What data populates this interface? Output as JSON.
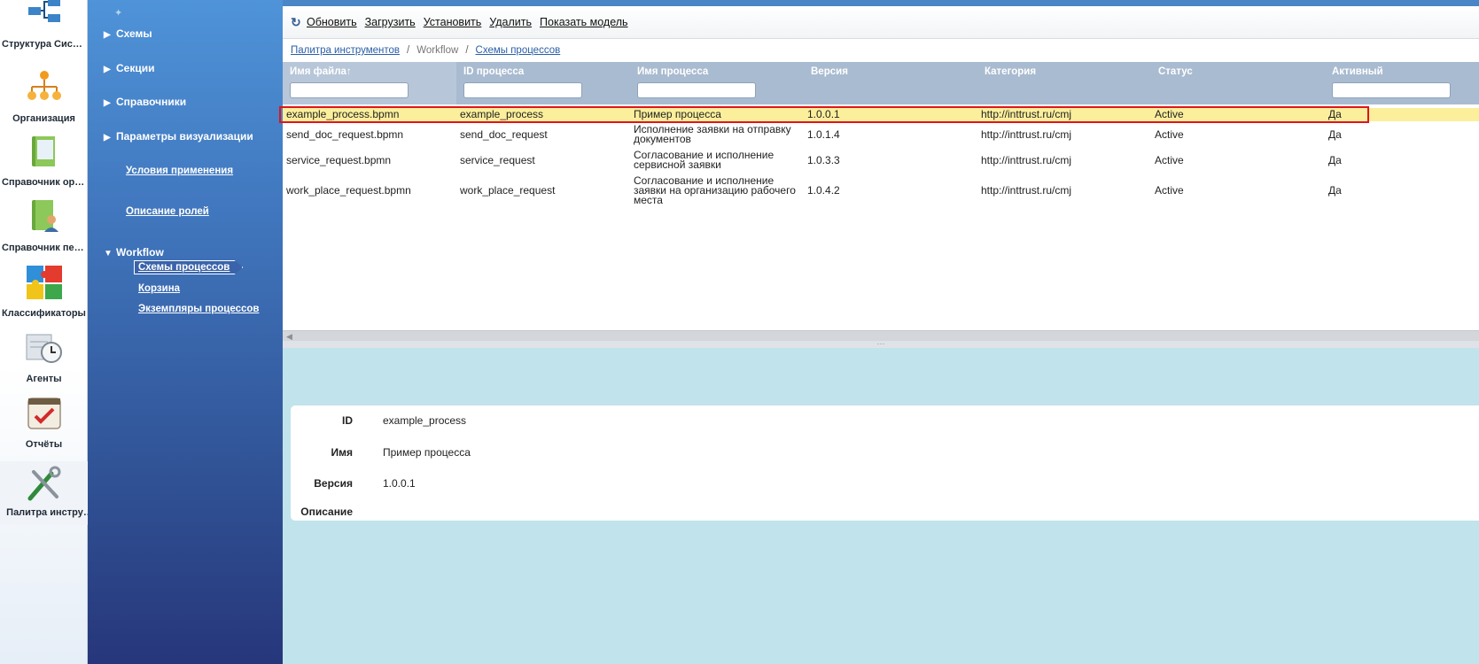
{
  "rail": [
    {
      "label": "Структура Сист…",
      "icon": "system-structure-icon"
    },
    {
      "label": "Организация",
      "icon": "organization-icon"
    },
    {
      "label": "Справочник орг…",
      "icon": "org-directory-icon"
    },
    {
      "label": "Справочник пер…",
      "icon": "personnel-directory-icon"
    },
    {
      "label": "Классификаторы",
      "icon": "classifiers-puzzle-icon"
    },
    {
      "label": "Агенты",
      "icon": "agents-clock-icon"
    },
    {
      "label": "Отчёты",
      "icon": "reports-calendar-icon"
    },
    {
      "label": "Палитра инстру…",
      "icon": "tools-palette-icon"
    }
  ],
  "nav": {
    "sections": [
      "Схемы",
      "Секции",
      "Справочники",
      "Параметры визуализации"
    ],
    "links": [
      "Условия применения",
      "Описание ролей"
    ],
    "workflow": {
      "label": "Workflow",
      "items": [
        "Схемы процессов",
        "Корзина",
        "Экземпляры процессов"
      ],
      "current": "Схемы процессов"
    }
  },
  "toolbar": {
    "refresh": "Обновить",
    "upload": "Загрузить",
    "install": "Установить",
    "delete": "Удалить",
    "show_model": "Показать модель"
  },
  "breadcrumb": {
    "root": "Палитра инструментов",
    "middle": "Workflow",
    "current": "Схемы процессов"
  },
  "table": {
    "columns": [
      "Имя файла↑",
      "ID процесса",
      "Имя процесса",
      "Версия",
      "Категория",
      "Статус",
      "Активный"
    ],
    "rows": [
      {
        "file": "example_process.bpmn",
        "id": "example_process",
        "name": "Пример процесса",
        "version": "1.0.0.1",
        "category": "http://inttrust.ru/cmj",
        "status": "Active",
        "active": "Да"
      },
      {
        "file": "send_doc_request.bpmn",
        "id": "send_doc_request",
        "name": "Исполнение заявки на отправку документов",
        "version": "1.0.1.4",
        "category": "http://inttrust.ru/cmj",
        "status": "Active",
        "active": "Да"
      },
      {
        "file": "service_request.bpmn",
        "id": "service_request",
        "name": "Согласование и исполнение сервисной заявки",
        "version": "1.0.3.3",
        "category": "http://inttrust.ru/cmj",
        "status": "Active",
        "active": "Да"
      },
      {
        "file": "work_place_request.bpmn",
        "id": "work_place_request",
        "name": "Согласование и исполнение заявки на организацию рабочего места",
        "version": "1.0.4.2",
        "category": "http://inttrust.ru/cmj",
        "status": "Active",
        "active": "Да"
      }
    ]
  },
  "detail": {
    "id_label": "ID",
    "id_value": "example_process",
    "name_label": "Имя",
    "name_value": "Пример процесса",
    "version_label": "Версия",
    "version_value": "1.0.0.1",
    "description_label": "Описание"
  },
  "colors": {
    "nav_top": "#4f93d8",
    "nav_bottom": "#27367a",
    "header": "#a9bbd0",
    "selected_row": "#fbef9c",
    "selection_frame": "#e0141b",
    "detail_bg": "#c0e3ec"
  }
}
